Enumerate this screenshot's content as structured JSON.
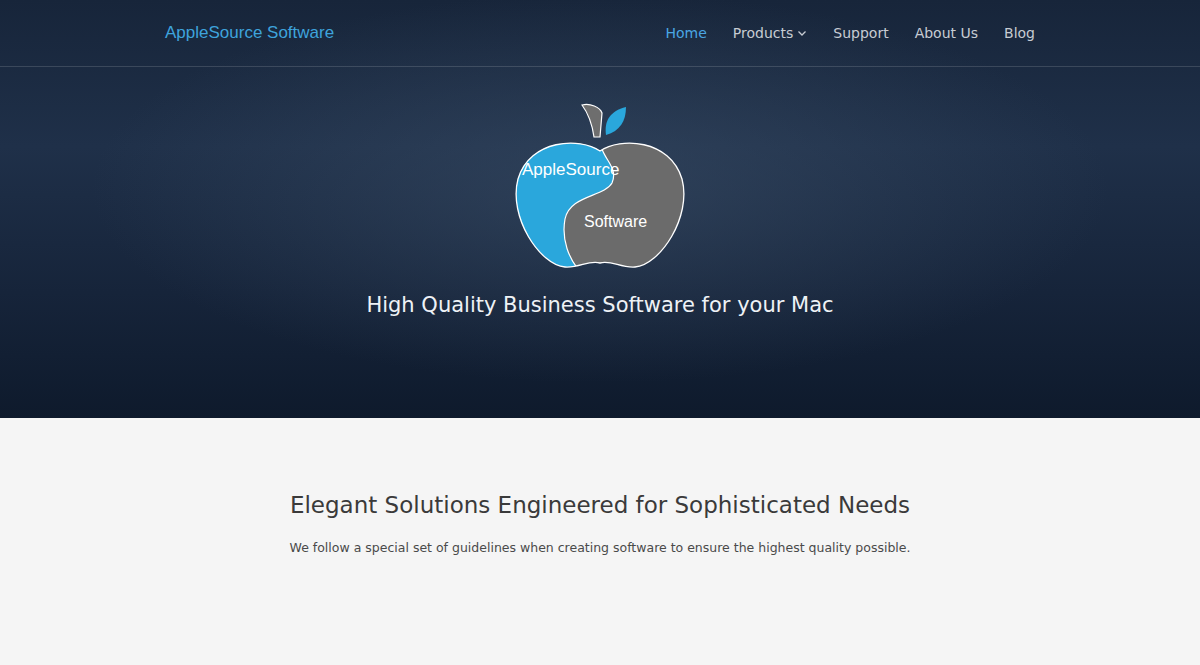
{
  "nav": {
    "brand": "AppleSource Software",
    "items": [
      {
        "label": "Home",
        "selected": true,
        "kind": "link"
      },
      {
        "label": "Products",
        "selected": false,
        "kind": "dropdown"
      },
      {
        "label": "Support",
        "selected": false,
        "kind": "link"
      },
      {
        "label": "About Us",
        "selected": false,
        "kind": "link"
      },
      {
        "label": "Blog",
        "selected": false,
        "kind": "link"
      }
    ]
  },
  "hero": {
    "logo": {
      "top": "AppleSource",
      "bottom": "Software"
    },
    "tagline": "High Quality Business Software for your Mac"
  },
  "intro": {
    "heading": "Elegant Solutions Engineered for Sophisticated Needs",
    "text": "We follow a special set of guidelines when creating software to ensure the highest quality possible."
  }
}
